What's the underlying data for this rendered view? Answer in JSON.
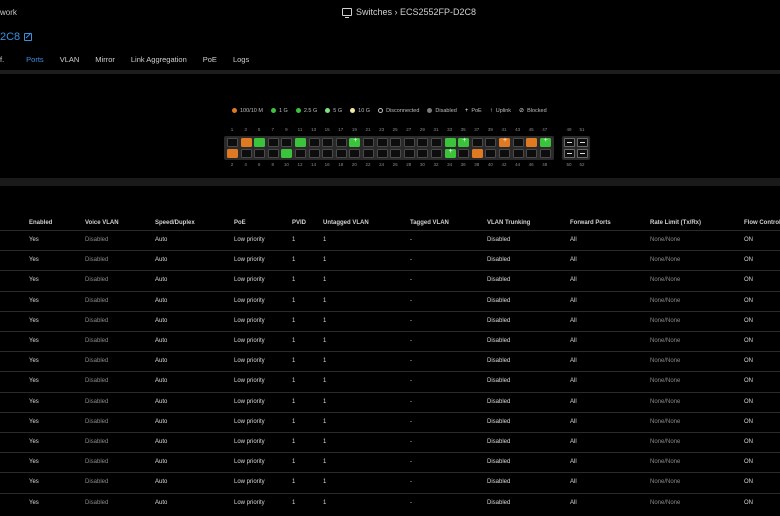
{
  "header": {
    "left_crumb": "work",
    "breadcrumb": "Switches › ECS2552FP-D2C8",
    "device_name": "2C8"
  },
  "tabs": [
    {
      "label": "f.",
      "active": false
    },
    {
      "label": "Ports",
      "active": true
    },
    {
      "label": "VLAN",
      "active": false
    },
    {
      "label": "Mirror",
      "active": false
    },
    {
      "label": "Link Aggregation",
      "active": false
    },
    {
      "label": "PoE",
      "active": false
    },
    {
      "label": "Logs",
      "active": false
    }
  ],
  "legend": [
    {
      "label": "100/10 M",
      "color": "#e07a22",
      "kind": "dot"
    },
    {
      "label": "1 G",
      "color": "#3cc33c",
      "kind": "dot"
    },
    {
      "label": "2.5 G",
      "color": "#3cc33c",
      "kind": "dot"
    },
    {
      "label": "5 G",
      "color": "#7fe07f",
      "kind": "dot"
    },
    {
      "label": "10 G",
      "color": "#f0e8a0",
      "kind": "dot"
    },
    {
      "label": "Disconnected",
      "color": "#bdbdbd",
      "kind": "ring"
    },
    {
      "label": "Disabled",
      "color": "#7a7a7a",
      "kind": "dot"
    },
    {
      "label": "PoE",
      "icon": "plus-icon",
      "kind": "glyph"
    },
    {
      "label": "Uplink",
      "icon": "uplink-icon",
      "kind": "glyph"
    },
    {
      "label": "Blocked",
      "icon": "blocked-icon",
      "kind": "glyph"
    }
  ],
  "ports": {
    "top_numbers": [
      "1",
      "3",
      "5",
      "7",
      "9",
      "11",
      "13",
      "15",
      "17",
      "19",
      "21",
      "23",
      "25",
      "27",
      "29",
      "31",
      "33",
      "35",
      "37",
      "39",
      "41",
      "43",
      "45",
      "47"
    ],
    "bottom_numbers": [
      "2",
      "4",
      "6",
      "8",
      "10",
      "12",
      "14",
      "16",
      "18",
      "20",
      "22",
      "24",
      "26",
      "28",
      "30",
      "32",
      "34",
      "36",
      "38",
      "40",
      "42",
      "44",
      "46",
      "48"
    ],
    "top_states": [
      "off",
      "orange",
      "green",
      "off",
      "off",
      "green",
      "off",
      "off",
      "off",
      "green-poe",
      "off",
      "off",
      "off",
      "off",
      "off",
      "off",
      "green",
      "green-poe",
      "off",
      "off",
      "orange-poe",
      "off",
      "orange",
      "green-poe"
    ],
    "bottom_states": [
      "orange",
      "off",
      "off",
      "off",
      "green",
      "off",
      "off",
      "off",
      "off",
      "off",
      "off",
      "off",
      "off",
      "off",
      "off",
      "off",
      "green-poe",
      "off",
      "orange",
      "off",
      "off",
      "off",
      "off",
      "off"
    ],
    "uplink_top": [
      "49",
      "51"
    ],
    "uplink_bottom": [
      "50",
      "52"
    ]
  },
  "table": {
    "columns": [
      "Enabled",
      "Voice VLAN",
      "Speed/Duplex",
      "PoE",
      "PVID",
      "Untagged VLAN",
      "Tagged VLAN",
      "VLAN Trunking",
      "Forward Ports",
      "Rate Limit (Tx/Rx)",
      "Flow Control"
    ],
    "rows": [
      [
        "Yes",
        "Disabled",
        "Auto",
        "Low priority",
        "1",
        "1",
        "-",
        "Disabled",
        "All",
        "None/None",
        "ON"
      ],
      [
        "Yes",
        "Disabled",
        "Auto",
        "Low priority",
        "1",
        "1",
        "-",
        "Disabled",
        "All",
        "None/None",
        "ON"
      ],
      [
        "Yes",
        "Disabled",
        "Auto",
        "Low priority",
        "1",
        "1",
        "-",
        "Disabled",
        "All",
        "None/None",
        "ON"
      ],
      [
        "Yes",
        "Disabled",
        "Auto",
        "Low priority",
        "1",
        "1",
        "-",
        "Disabled",
        "All",
        "None/None",
        "ON"
      ],
      [
        "Yes",
        "Disabled",
        "Auto",
        "Low priority",
        "1",
        "1",
        "-",
        "Disabled",
        "All",
        "None/None",
        "ON"
      ],
      [
        "Yes",
        "Disabled",
        "Auto",
        "Low priority",
        "1",
        "1",
        "-",
        "Disabled",
        "All",
        "None/None",
        "ON"
      ],
      [
        "Yes",
        "Disabled",
        "Auto",
        "Low priority",
        "1",
        "1",
        "-",
        "Disabled",
        "All",
        "None/None",
        "ON"
      ],
      [
        "Yes",
        "Disabled",
        "Auto",
        "Low priority",
        "1",
        "1",
        "-",
        "Disabled",
        "All",
        "None/None",
        "ON"
      ],
      [
        "Yes",
        "Disabled",
        "Auto",
        "Low priority",
        "1",
        "1",
        "-",
        "Disabled",
        "All",
        "None/None",
        "ON"
      ],
      [
        "Yes",
        "Disabled",
        "Auto",
        "Low priority",
        "1",
        "1",
        "-",
        "Disabled",
        "All",
        "None/None",
        "ON"
      ],
      [
        "Yes",
        "Disabled",
        "Auto",
        "Low priority",
        "1",
        "1",
        "-",
        "Disabled",
        "All",
        "None/None",
        "ON"
      ],
      [
        "Yes",
        "Disabled",
        "Auto",
        "Low priority",
        "1",
        "1",
        "-",
        "Disabled",
        "All",
        "None/None",
        "ON"
      ],
      [
        "Yes",
        "Disabled",
        "Auto",
        "Low priority",
        "1",
        "1",
        "-",
        "Disabled",
        "All",
        "None/None",
        "ON"
      ],
      [
        "Yes",
        "Disabled",
        "Auto",
        "Low priority",
        "1",
        "1",
        "-",
        "Disabled",
        "All",
        "None/None",
        "ON"
      ]
    ]
  }
}
